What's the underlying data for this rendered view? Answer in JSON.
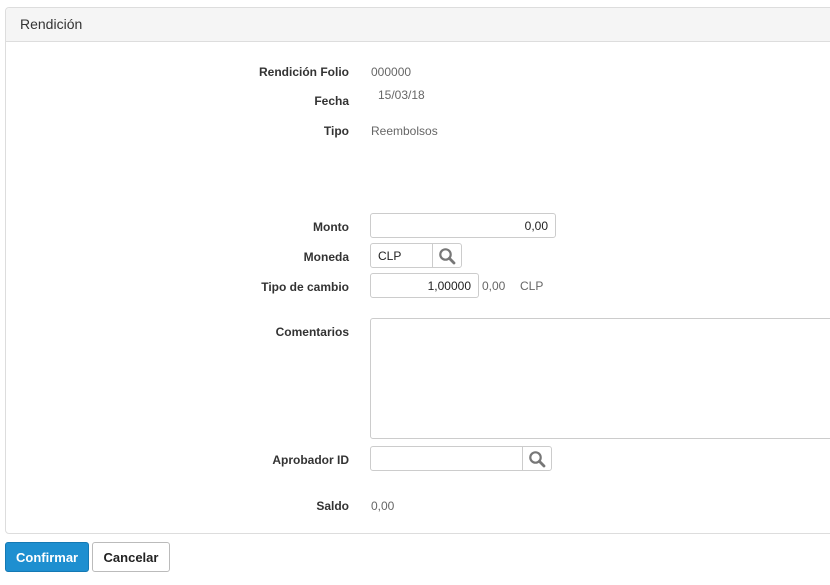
{
  "panel": {
    "title": "Rendición"
  },
  "form": {
    "folio": {
      "label": "Rendición Folio",
      "value": "000000"
    },
    "fecha": {
      "label": "Fecha",
      "value": "15/03/18"
    },
    "tipo": {
      "label": "Tipo",
      "value": "Reembolsos"
    },
    "monto": {
      "label": "Monto",
      "value": "0,00"
    },
    "moneda": {
      "label": "Moneda",
      "value": "CLP"
    },
    "tipo_cambio": {
      "label": "Tipo de cambio",
      "value": "1,00000",
      "converted": "0,00",
      "currency": "CLP"
    },
    "comentarios": {
      "label": "Comentarios",
      "value": ""
    },
    "aprobador": {
      "label": "Aprobador ID",
      "value": ""
    },
    "saldo": {
      "label": "Saldo",
      "value": "0,00"
    }
  },
  "actions": {
    "confirm": "Confirmar",
    "cancel": "Cancelar"
  },
  "colors": {
    "primary": "#1e8fd0",
    "border": "#cccccc",
    "heading_bg": "#f5f5f5"
  },
  "icons": {
    "lookup": "search-icon"
  }
}
